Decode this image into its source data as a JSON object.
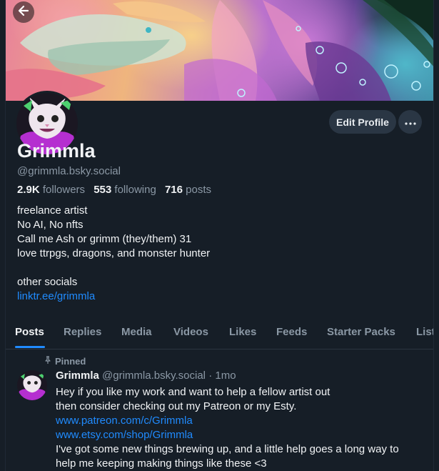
{
  "profile": {
    "display_name": "Grimmla",
    "handle": "@grimmla.bsky.social",
    "followers_count": "2.9K",
    "followers_label": "followers",
    "following_count": "553",
    "following_label": "following",
    "posts_count": "716",
    "posts_label": "posts",
    "edit_label": "Edit Profile",
    "more_label": "···",
    "bio_lines": [
      "freelance artist",
      "No AI, No nfts",
      "Call me Ash or grimm (they/them) 31",
      "love ttrpgs, dragons, and monster hunter",
      "",
      "other socials"
    ],
    "link": "linktr.ee/grimmla"
  },
  "tabs": [
    {
      "label": "Posts",
      "active": true
    },
    {
      "label": "Replies",
      "active": false
    },
    {
      "label": "Media",
      "active": false
    },
    {
      "label": "Videos",
      "active": false
    },
    {
      "label": "Likes",
      "active": false
    },
    {
      "label": "Feeds",
      "active": false
    },
    {
      "label": "Starter Packs",
      "active": false
    },
    {
      "label": "List",
      "active": false
    }
  ],
  "post": {
    "pinned_label": "Pinned",
    "author_name": "Grimmla",
    "author_handle": "@grimmla.bsky.social",
    "separator": "·",
    "age": "1mo",
    "lines": [
      "Hey if you like my work and want to help a fellow artist out",
      "then consider checking out my Patreon or my Esty."
    ],
    "links": [
      "www.patreon.com/c/Grimmla",
      "www.etsy.com/shop/Grimmla"
    ],
    "tail_lines": [
      "I've got some new things brewing up, and a little help goes a long way to",
      "help me keeping making things like these <3"
    ]
  },
  "colors": {
    "background": "#161e27",
    "accent": "#208bfe",
    "muted": "#8b98a5",
    "button": "#2a3644"
  },
  "icons": {
    "back": "arrow-left-icon",
    "pinned": "pin-icon",
    "more": "ellipsis-icon"
  }
}
